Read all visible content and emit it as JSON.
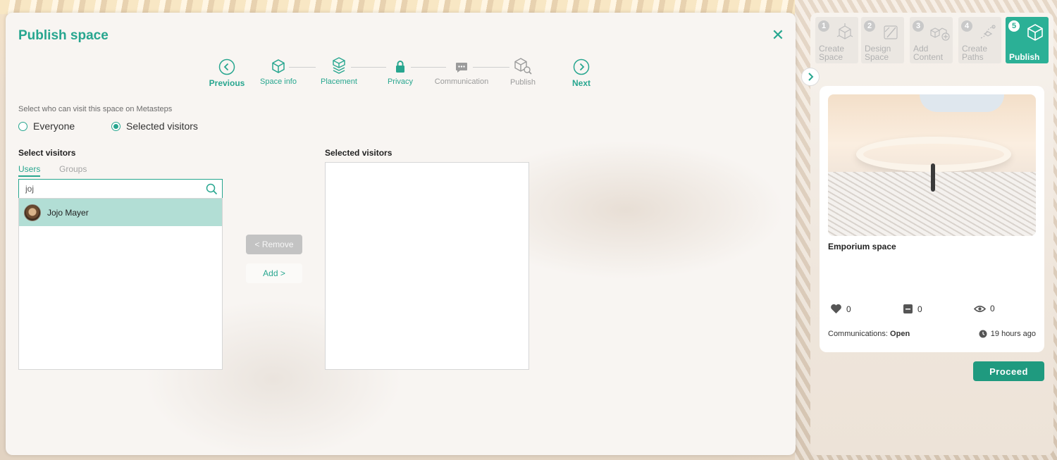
{
  "modal": {
    "title": "Publish space",
    "stepper": {
      "previous": "Previous",
      "next": "Next",
      "steps": [
        "Space info",
        "Placement",
        "Privacy",
        "Communication",
        "Publish"
      ]
    },
    "visit_label": "Select who can visit this space on Metasteps",
    "radios": {
      "everyone": "Everyone",
      "selected": "Selected visitors",
      "selected_value": "Selected visitors"
    },
    "select_visitors": {
      "label": "Select visitors",
      "tabs": [
        "Users",
        "Groups"
      ],
      "active_tab": "Users",
      "search_value": "joj",
      "results": [
        {
          "name": "Jojo Mayer"
        }
      ]
    },
    "selected_visitors": {
      "label": "Selected visitors",
      "items": []
    },
    "buttons": {
      "remove": "< Remove",
      "add": "Add >"
    }
  },
  "wizard": {
    "steps": [
      {
        "num": "1",
        "line1": "Create",
        "line2": "Space"
      },
      {
        "num": "2",
        "line1": "Design",
        "line2": "Space"
      },
      {
        "num": "3",
        "line1": "Add",
        "line2": "Content"
      },
      {
        "num": "4",
        "line1": "Create",
        "line2": "Paths"
      },
      {
        "num": "5",
        "line1": "Publish",
        "line2": ""
      }
    ],
    "active": "5"
  },
  "card": {
    "title": "Emporium space",
    "likes": "0",
    "comments": "0",
    "views": "0",
    "communications_label": "Communications:",
    "communications_value": "Open",
    "time": "19 hours ago"
  },
  "proceed": "Proceed",
  "colors": {
    "accent": "#27a68f",
    "proceed": "#1f9a7f",
    "selected_row": "#b2ded5"
  }
}
